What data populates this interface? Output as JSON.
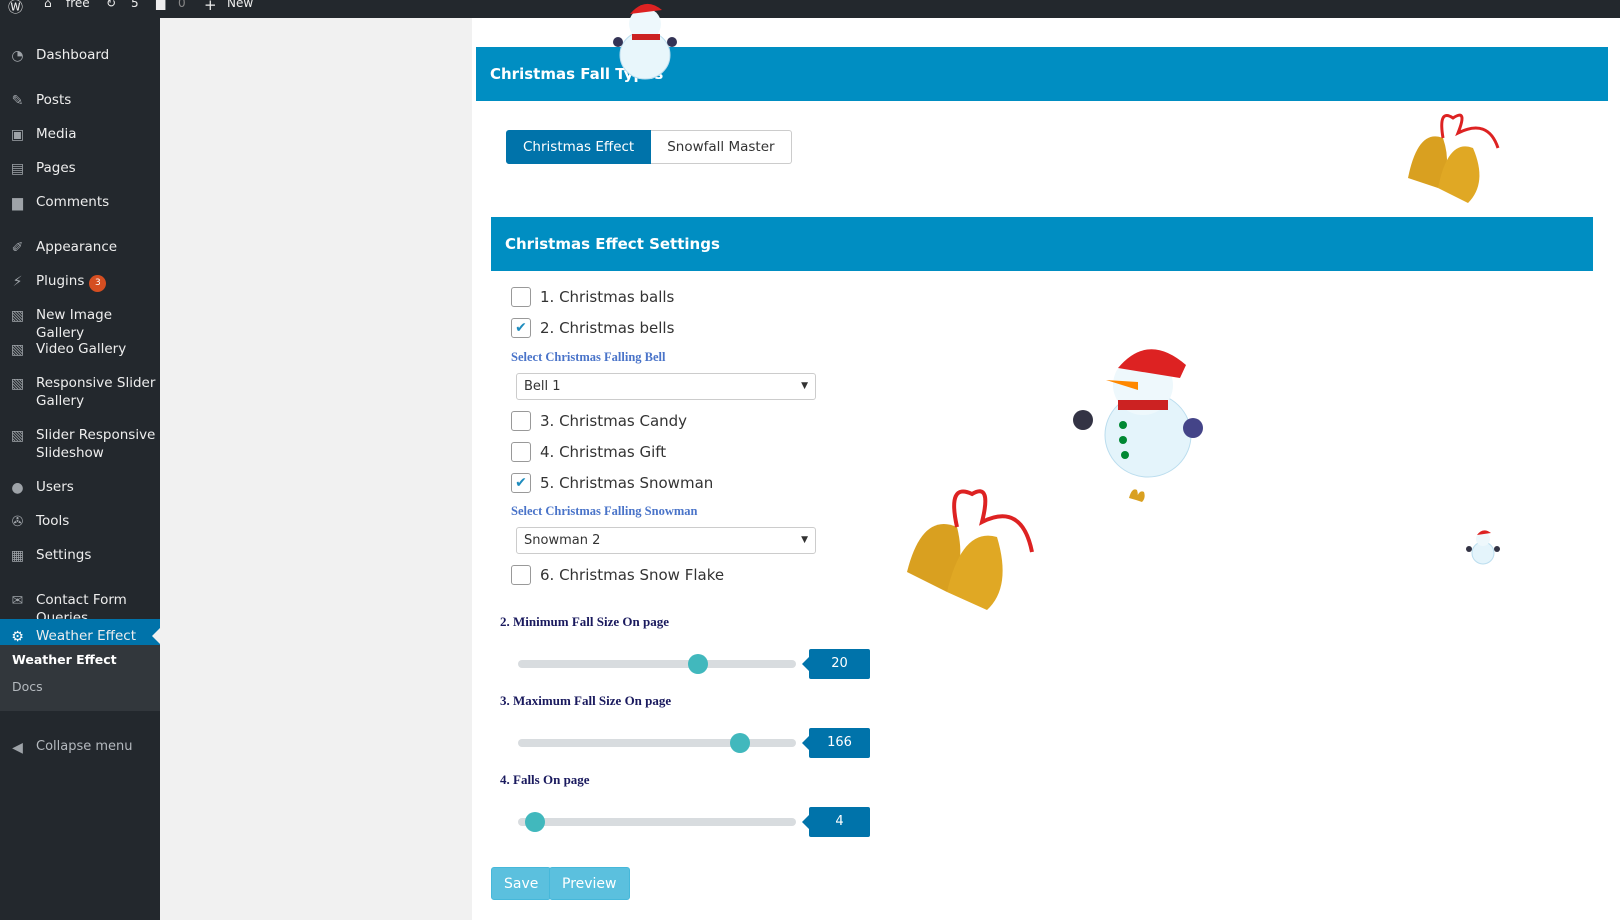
{
  "adminbar": {
    "site": "free",
    "updates": "5",
    "comments": "0",
    "new": "New"
  },
  "sidebar": {
    "items": [
      {
        "label": "Dashboard",
        "icon": "dashboard-icon",
        "glyph": "◔"
      },
      {
        "label": "Posts",
        "icon": "pin-icon",
        "glyph": "✎"
      },
      {
        "label": "Media",
        "icon": "media-icon",
        "glyph": "▣"
      },
      {
        "label": "Pages",
        "icon": "pages-icon",
        "glyph": "▤"
      },
      {
        "label": "Comments",
        "icon": "comment-icon",
        "glyph": "▆"
      },
      {
        "label": "Appearance",
        "icon": "brush-icon",
        "glyph": "✐"
      },
      {
        "label": "Plugins",
        "icon": "plugin-icon",
        "glyph": "⚡",
        "badge": "3"
      },
      {
        "label": "New Image Gallery",
        "icon": "gallery-icon",
        "glyph": "▧"
      },
      {
        "label": "Video Gallery",
        "icon": "gallery-icon",
        "glyph": "▧"
      },
      {
        "label": "Responsive Slider Gallery",
        "icon": "gallery-icon",
        "glyph": "▧"
      },
      {
        "label": "Slider Responsive Slideshow",
        "icon": "gallery-icon",
        "glyph": "▧"
      },
      {
        "label": "Users",
        "icon": "user-icon",
        "glyph": "●"
      },
      {
        "label": "Tools",
        "icon": "wrench-icon",
        "glyph": "✇"
      },
      {
        "label": "Settings",
        "icon": "settings-icon",
        "glyph": "▦"
      },
      {
        "label": "Contact Form Queries",
        "icon": "mail-icon",
        "glyph": "✉"
      },
      {
        "label": "Weather Effect",
        "icon": "gear-icon",
        "glyph": "⚙"
      }
    ],
    "submenu": [
      "Weather Effect",
      "Docs"
    ],
    "collapse": "Collapse menu"
  },
  "main": {
    "fall_types_title": "Christmas Fall Types",
    "tabs": [
      "Christmas Effect",
      "Snowfall Master"
    ],
    "settings_title": "Christmas Effect Settings",
    "options": [
      {
        "label": "1. Christmas balls",
        "checked": false
      },
      {
        "label": "2. Christmas bells",
        "checked": true
      },
      {
        "label": "3. Christmas Candy",
        "checked": false
      },
      {
        "label": "4. Christmas Gift",
        "checked": false
      },
      {
        "label": "5. Christmas Snowman",
        "checked": true
      },
      {
        "label": "6. Christmas Snow Flake",
        "checked": false
      }
    ],
    "bell_label": "Select Christmas Falling Bell",
    "bell_value": "Bell 1",
    "snowman_label": "Select Christmas Falling Snowman",
    "snowman_value": "Snowman 2",
    "sliders": [
      {
        "label": "2. Minimum Fall Size On page",
        "value": "20"
      },
      {
        "label": "3. Maximum Fall Size On page",
        "value": "166"
      },
      {
        "label": "4. Falls On page",
        "value": "4"
      }
    ],
    "save": "Save",
    "preview": "Preview"
  },
  "colors": {
    "accent": "#008ec2",
    "active": "#0073aa",
    "thumb": "#41b8bd"
  }
}
